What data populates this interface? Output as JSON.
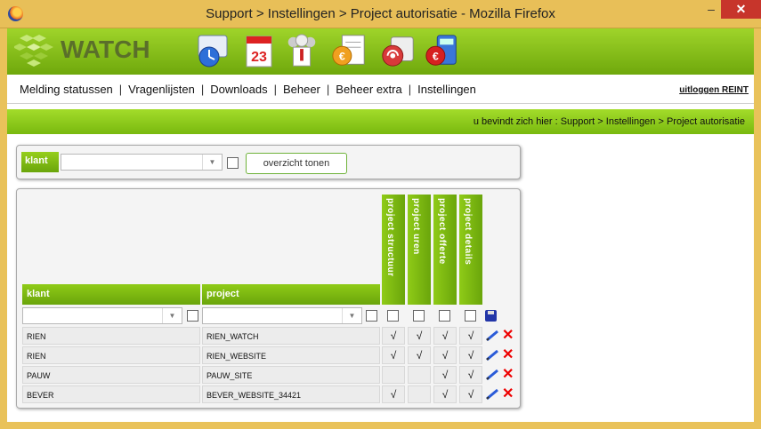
{
  "window": {
    "title": "Support > Instellingen > Project autorisatie - Mozilla Firefox",
    "min_glyph": "–",
    "max_glyph": "□",
    "close_glyph": "✕"
  },
  "app": {
    "logo_text": "WATCH",
    "toolbar_icons": [
      "clock-icon",
      "calendar-icon",
      "users-icon",
      "invoice-icon",
      "phone-icon",
      "euro-calculator-icon"
    ],
    "calendar_day": "23"
  },
  "menu": {
    "items": [
      "Melding statussen",
      "Vragenlijsten",
      "Downloads",
      "Beheer",
      "Beheer extra",
      "Instellingen"
    ],
    "logout": "uitloggen REINT"
  },
  "breadcrumb": "u bevindt zich hier : Support > Instellingen > Project autorisatie",
  "filter": {
    "klant_label": "klant",
    "klant_value": "",
    "show_button": "overzicht tonen"
  },
  "grid": {
    "col_klant": "klant",
    "col_project": "project",
    "perm_headers": [
      "project structuur",
      "project uren",
      "project offerte",
      "project details"
    ],
    "check_mark": "√",
    "rows": [
      {
        "klant": "RIEN",
        "project": "RIEN_WATCH",
        "perms": [
          "√",
          "√",
          "√",
          "√"
        ]
      },
      {
        "klant": "RIEN",
        "project": "RIEN_WEBSITE",
        "perms": [
          "√",
          "√",
          "√",
          "√"
        ]
      },
      {
        "klant": "PAUW",
        "project": "PAUW_SITE",
        "perms": [
          "",
          "",
          "√",
          "√"
        ]
      },
      {
        "klant": "BEVER",
        "project": "BEVER_WEBSITE_34421",
        "perms": [
          "√",
          "",
          "√",
          "√"
        ]
      }
    ]
  },
  "colors": {
    "accent_green": "#8fcb17",
    "delete_red": "#e00000",
    "title_bar": "#e8bf58"
  }
}
